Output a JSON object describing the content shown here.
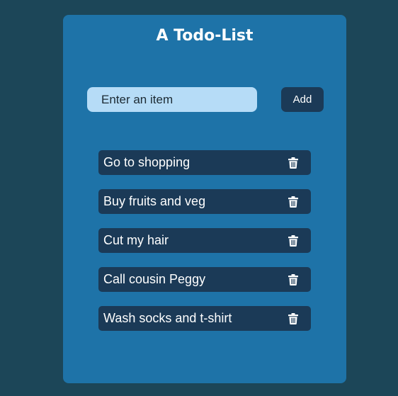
{
  "app": {
    "title": "A Todo-List"
  },
  "input": {
    "placeholder": "Enter an item",
    "value": ""
  },
  "add_button": {
    "label": "Add"
  },
  "todos": [
    {
      "text": "Go to shopping",
      "icon": "trash-icon"
    },
    {
      "text": "Buy fruits and veg",
      "icon": "trash-icon"
    },
    {
      "text": "Cut my hair",
      "icon": "trash-icon"
    },
    {
      "text": "Call cousin Peggy",
      "icon": "trash-icon"
    },
    {
      "text": "Wash socks and t-shirt",
      "icon": "trash-icon"
    }
  ],
  "colors": {
    "page_background": "#1c4658",
    "card_background": "#1e73a8",
    "input_background": "#b6dcf7",
    "item_background": "#1b3a57",
    "button_background": "#1b3a57",
    "text_light": "#ffffff",
    "text_dark": "#1c2a33"
  }
}
